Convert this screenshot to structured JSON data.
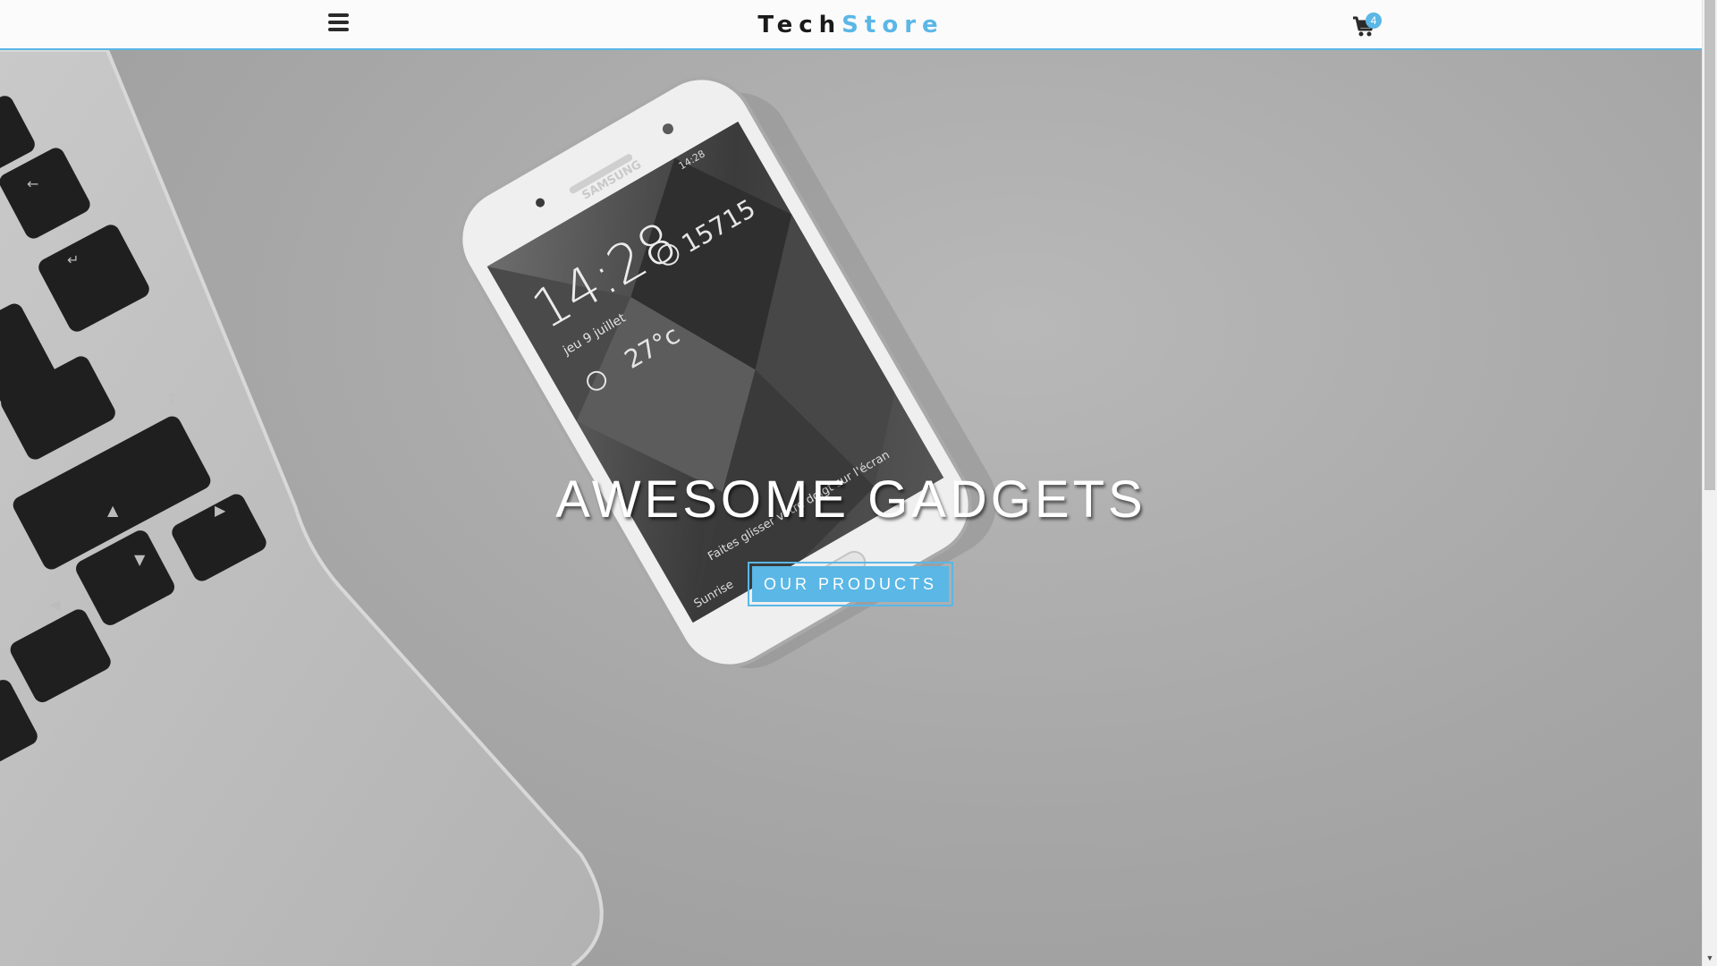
{
  "nav": {
    "brand_main": "Tech",
    "brand_accent": "Store",
    "menu_icon": "hamburger-menu-icon",
    "cart_icon": "shopping-cart-icon",
    "cart_count": "4"
  },
  "hero": {
    "title": "AWESOME GADGETS",
    "cta_label": "OUR PRODUCTS",
    "phone_screen": {
      "time": "14:28",
      "date": "jeu 9 juillet",
      "temperature": "27°c",
      "steps": "15715",
      "swipe_hint": "Faites glisser votre doigt sur l'écran",
      "location": "Sunrise",
      "status_time": "14:28",
      "brand": "SAMSUNG"
    }
  },
  "colors": {
    "accent": "#5ab7e6",
    "nav_background": "#fbfbfb",
    "hero_overlay": "#a6a6a6",
    "title_text": "#ffffff"
  }
}
